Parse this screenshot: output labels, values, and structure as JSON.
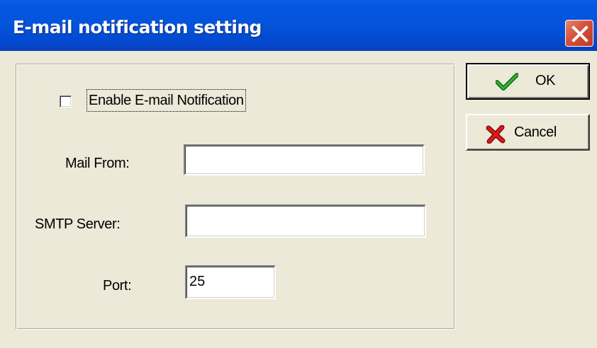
{
  "window": {
    "title": "E-mail notification setting",
    "close_icon": "close-icon"
  },
  "form": {
    "enable_label": "Enable E-mail Notification",
    "enable_checked": false,
    "mail_from": {
      "label": "Mail From:",
      "value": ""
    },
    "smtp_server": {
      "label": "SMTP Server:",
      "value": ""
    },
    "port": {
      "label": "Port:",
      "value": "25"
    }
  },
  "buttons": {
    "ok": {
      "label": "OK",
      "icon": "checkmark-icon",
      "icon_color": "#1f8f1f"
    },
    "cancel": {
      "label": "Cancel",
      "icon": "x-icon",
      "icon_color": "#c01818"
    }
  },
  "colors": {
    "titlebar": "#0453db",
    "dialog_face": "#ece9d8",
    "close_button": "#d5503a"
  }
}
